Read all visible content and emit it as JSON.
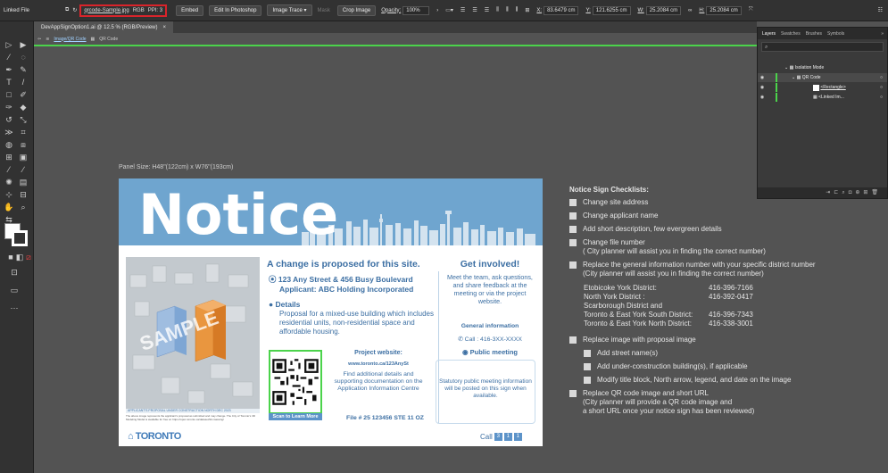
{
  "controlbar": {
    "left_label": "Linked File",
    "file_name": "qrcode-Sample.jpg",
    "color_mode": "RGB",
    "ppi": "PPI: 3",
    "embed": "Embed",
    "edit": "Edit In Photoshop",
    "trace": "Image Trace",
    "mask": "Mask",
    "crop": "Crop Image",
    "opacity_label": "Opacity:",
    "opacity_value": "100%",
    "x_label": "X:",
    "x_value": "83.6479 cm",
    "y_label": "Y:",
    "y_value": "121.6255 cm",
    "w_label": "W:",
    "w_value": "25.2084 cm",
    "h_label": "H:",
    "h_value": "25.2084 cm"
  },
  "document": {
    "tab_title": "DevAppSignOption1.ai @ 12.5 % (RGB/Preview)",
    "tab_close": "×",
    "crumb_1": "Image/QR Code",
    "crumb_2": "QR Code"
  },
  "canvas": {
    "panel_size": "Panel Size: H48\"(122cm) x W76\"(193cm)"
  },
  "sign": {
    "notice": "Notice",
    "sample_watermark": "SAMPLE",
    "legend": "APPLICANT'S PROPOSAL  UNDER CONSTRUCTION  NORTH DEC 2023",
    "disclaimer": "The above image represents the applicant's proposal as submitted and may change. The City of Toronto's 3D Modeling Model is available for free at: https://open.toronto.ca/dataset/3d-massing/",
    "logo": "TORONTO",
    "proposed_title": "A change is proposed for this site.",
    "address_line1": "123 Any Street & 456 Busy Boulevard",
    "address_line2": "Applicant: ABC Holding Incorporated",
    "details_head": "Details",
    "details_text": "Proposal for a mixed-use building which includes residential units, non-residential space and affordable housing.",
    "qr_cta": "Scan to Learn More",
    "project_website": "Project website:",
    "project_url": "www.toronto.ca/123AnySt",
    "project_find": "Find additional details and supporting documentation on the Application Information Centre",
    "file_no": "File # 25 123456 STE 11 OZ",
    "involved": "Get involved!",
    "meet": "Meet the team, ask questions, and share feedback at the meeting or via the project website.",
    "general_info": "General information",
    "call_line": "Call : 416-3XX-XXXX",
    "public_meeting": "Public meeting",
    "meeting_text": "Statutory public meeting information will be posted on this sign when available.",
    "call_foot": "Call",
    "call_boxes": [
      "3",
      "1",
      "1"
    ]
  },
  "checklist": {
    "title": "Notice Sign Checklists:",
    "items": [
      "Change site address",
      "Change applicant name",
      "Add short description, few evergreen details",
      "Change file number",
      "Replace the general information number with your specific district number",
      "Replace image with proposal image",
      "Replace QR code image and short URL"
    ],
    "file_note": "( City planner will assist you in finding the correct number)",
    "gen_note": "(City planner will assist you in finding the correct number)",
    "districts": [
      [
        "Etobicoke York District:",
        "416-396-7166"
      ],
      [
        "North York District :",
        "416-392-0417"
      ],
      [
        "Scarborough District and",
        ""
      ],
      [
        "Toronto & East York South District:",
        "416-396-7343"
      ],
      [
        "Toronto & East York North District:",
        "416-338-3001"
      ]
    ],
    "sub_items": [
      "Add street name(s)",
      "Add under-construction building(s), if applicable",
      "Modify title block, North arrow, legend, and date on the image"
    ],
    "qr_note1": "(City planner will provide a QR code image and",
    "qr_note2": "a short URL once your notice sign has been reviewed)"
  },
  "layers": {
    "tabs": [
      "Layers",
      "Swatches",
      "Brushes",
      "Symbols"
    ],
    "rows": [
      "Isolation Mode",
      "QR Code",
      "<Rectangle>",
      "<Linked Im..."
    ]
  },
  "colors": {
    "sign_blue": "#6fa5cf",
    "text_blue": "#3c6fa3",
    "highlight_red": "#d9242b",
    "isolation_green": "#4bd34b"
  }
}
